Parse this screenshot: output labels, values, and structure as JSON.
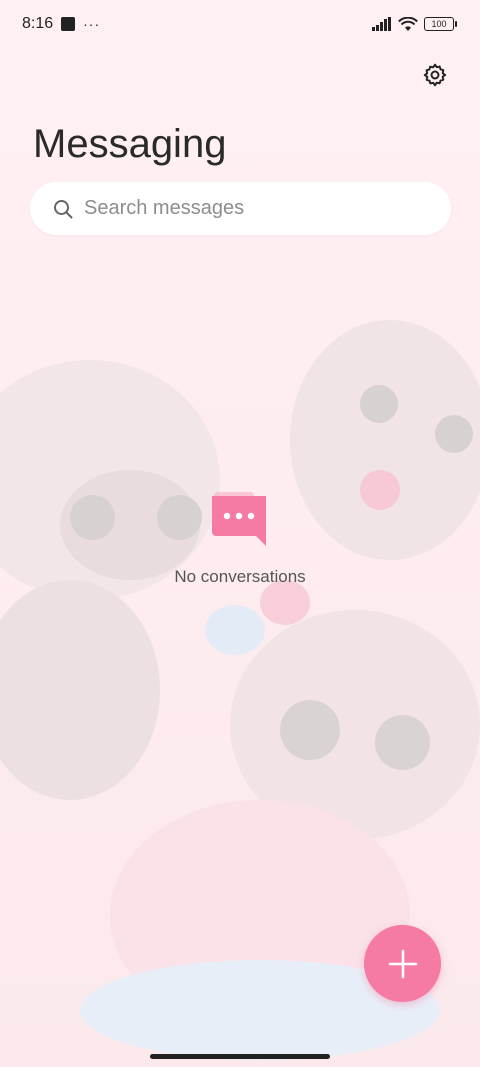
{
  "status_bar": {
    "time": "8:16",
    "more": "···",
    "battery": "100"
  },
  "header": {
    "title": "Messaging",
    "settings_icon": "gear-icon"
  },
  "search": {
    "placeholder": "Search messages",
    "icon": "search-icon"
  },
  "empty_state": {
    "icon": "chat-bubble-icon",
    "text": "No conversations"
  },
  "fab": {
    "icon": "plus-icon"
  },
  "colors": {
    "accent": "#f57ba4",
    "background": "#ffeef1"
  }
}
